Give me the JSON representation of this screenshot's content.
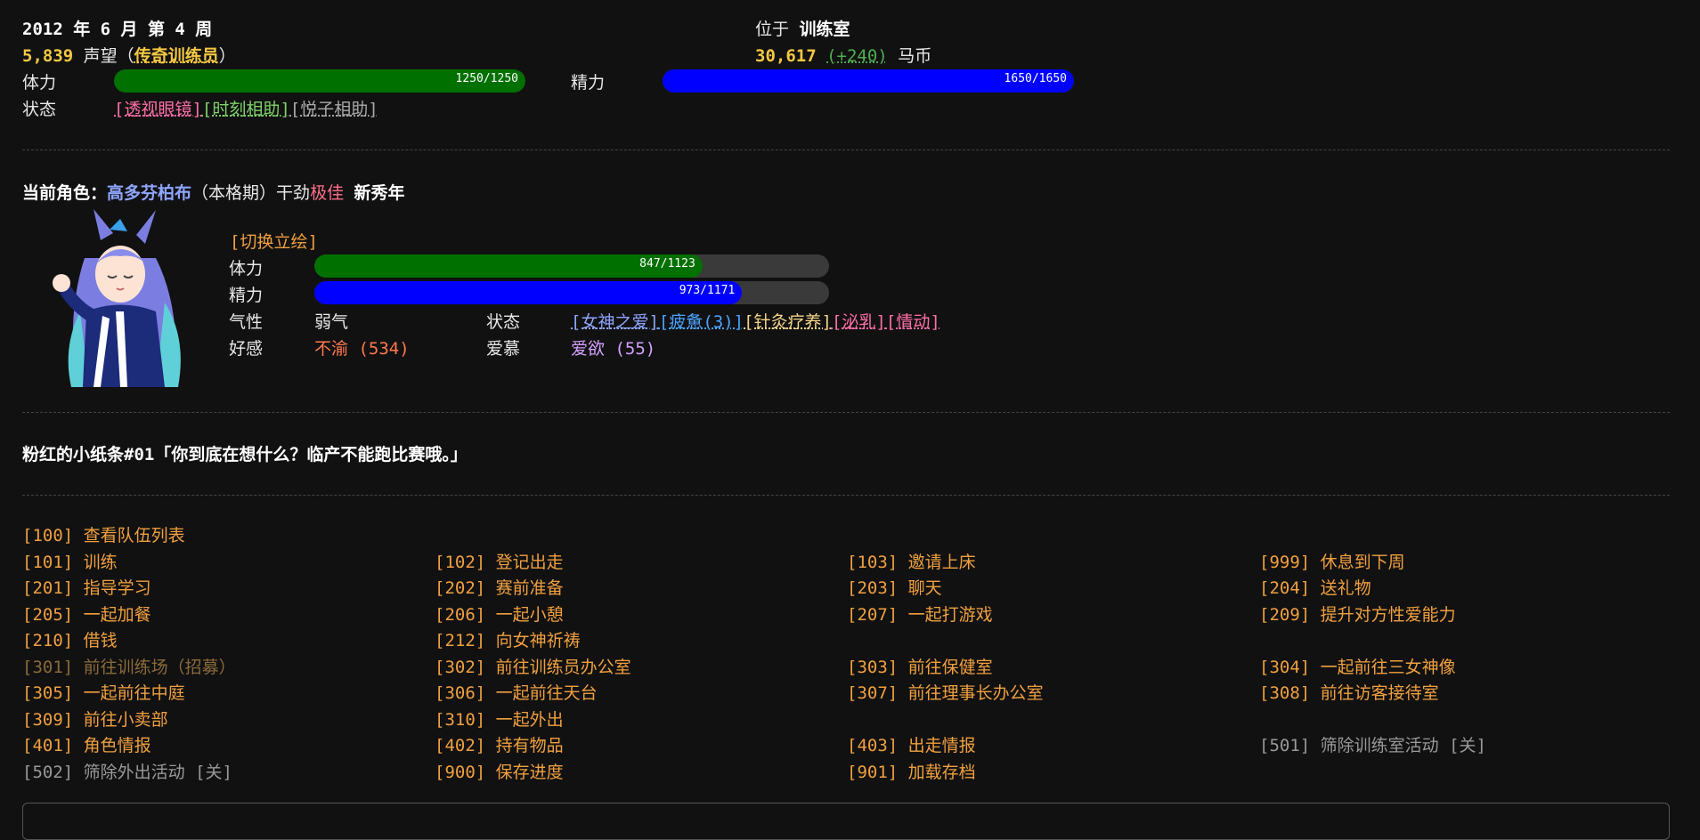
{
  "header": {
    "date": "2012 年 6 月 第 4 周",
    "reputation_value": "5,839",
    "reputation_label": "声望",
    "rank_open": "（",
    "rank": "传奇训练员",
    "rank_close": "）",
    "location_label": "位于",
    "location": "训练室",
    "money": "30,617",
    "money_delta": "(+240)",
    "money_unit": "马币"
  },
  "player": {
    "stamina_label": "体力",
    "stamina_text": "1250/1250",
    "stamina_fraction": 1.0,
    "energy_label": "精力",
    "energy_text": "1650/1650",
    "energy_fraction": 1.0,
    "status_label": "状态",
    "statuses": [
      {
        "text": "[透视眼镜]",
        "color": "#ff6fa8"
      },
      {
        "text": "[时刻相助]",
        "color": "#7fd36a"
      },
      {
        "text": "[悦子相助]",
        "color": "#aaaaaa"
      }
    ]
  },
  "character": {
    "prefix": "当前角色：",
    "name": "高多芬柏布",
    "period": "（本格期）",
    "drive_label": "干劲",
    "drive_value": "极佳",
    "tag": "新秀年",
    "switch_portrait": "[切换立绘]",
    "stamina_label": "体力",
    "stamina_text": "847/1123",
    "stamina_fraction": 0.754,
    "energy_label": "精力",
    "energy_text": "973/1171",
    "energy_fraction": 0.831,
    "temper_label": "气性",
    "temper_value": "弱气",
    "status_label": "状态",
    "statuses": [
      {
        "text": "[女神之爱]",
        "color": "#8fa6ff"
      },
      {
        "text": "[疲惫(3)]",
        "color": "#4aa3ff"
      },
      {
        "text": "[针灸疗养]",
        "color": "#f5d58a"
      },
      {
        "text": "[泌乳]",
        "color": "#ff6fa8"
      },
      {
        "text": "[情动]",
        "color": "#ff6fa8"
      }
    ],
    "affection_label": "好感",
    "affection_value": "不渝 (534)",
    "love_label": "爱慕",
    "love_value": "爱欲 (55)"
  },
  "note": {
    "title": "粉红的小纸条#01",
    "text": "「你到底在想什么？临产不能跑比赛哦。」"
  },
  "menu": [
    {
      "text": "[100] 查看队伍列表",
      "col": 0,
      "row": 0,
      "style": "normal"
    },
    {
      "text": "[101] 训练",
      "col": 0,
      "row": 1,
      "style": "normal"
    },
    {
      "text": "[102] 登记出走",
      "col": 1,
      "row": 1,
      "style": "normal"
    },
    {
      "text": "[103] 邀请上床",
      "col": 2,
      "row": 1,
      "style": "normal"
    },
    {
      "text": "[999] 休息到下周",
      "col": 3,
      "row": 1,
      "style": "normal"
    },
    {
      "text": "[201] 指导学习",
      "col": 0,
      "row": 2,
      "style": "normal"
    },
    {
      "text": "[202] 赛前准备",
      "col": 1,
      "row": 2,
      "style": "normal"
    },
    {
      "text": "[203] 聊天",
      "col": 2,
      "row": 2,
      "style": "normal"
    },
    {
      "text": "[204] 送礼物",
      "col": 3,
      "row": 2,
      "style": "normal"
    },
    {
      "text": "[205] 一起加餐",
      "col": 0,
      "row": 3,
      "style": "normal"
    },
    {
      "text": "[206] 一起小憩",
      "col": 1,
      "row": 3,
      "style": "normal"
    },
    {
      "text": "[207] 一起打游戏",
      "col": 2,
      "row": 3,
      "style": "normal"
    },
    {
      "text": "[209] 提升对方性爱能力",
      "col": 3,
      "row": 3,
      "style": "normal"
    },
    {
      "text": "[210] 借钱",
      "col": 0,
      "row": 4,
      "style": "normal"
    },
    {
      "text": "[212] 向女神祈祷",
      "col": 1,
      "row": 4,
      "style": "normal"
    },
    {
      "text": "[301] 前往训练场（招募）",
      "col": 0,
      "row": 5,
      "style": "dim"
    },
    {
      "text": "[302] 前往训练员办公室",
      "col": 1,
      "row": 5,
      "style": "normal"
    },
    {
      "text": "[303] 前往保健室",
      "col": 2,
      "row": 5,
      "style": "normal"
    },
    {
      "text": "[304] 一起前往三女神像",
      "col": 3,
      "row": 5,
      "style": "normal"
    },
    {
      "text": "[305] 一起前往中庭",
      "col": 0,
      "row": 6,
      "style": "normal"
    },
    {
      "text": "[306] 一起前往天台",
      "col": 1,
      "row": 6,
      "style": "normal"
    },
    {
      "text": "[307] 前往理事长办公室",
      "col": 2,
      "row": 6,
      "style": "normal"
    },
    {
      "text": "[308] 前往访客接待室",
      "col": 3,
      "row": 6,
      "style": "normal"
    },
    {
      "text": "[309] 前往小卖部",
      "col": 0,
      "row": 7,
      "style": "normal"
    },
    {
      "text": "[310] 一起外出",
      "col": 1,
      "row": 7,
      "style": "normal"
    },
    {
      "text": "[401] 角色情报",
      "col": 0,
      "row": 8,
      "style": "normal"
    },
    {
      "text": "[402] 持有物品",
      "col": 1,
      "row": 8,
      "style": "normal"
    },
    {
      "text": "[403] 出走情报",
      "col": 2,
      "row": 8,
      "style": "normal"
    },
    {
      "text": "[501] 筛除训练室活动 [关]",
      "col": 3,
      "row": 8,
      "style": "gray"
    },
    {
      "text": "[502] 筛除外出活动 [关]",
      "col": 0,
      "row": 9,
      "style": "gray"
    },
    {
      "text": "[900] 保存进度",
      "col": 1,
      "row": 9,
      "style": "normal"
    },
    {
      "text": "[901] 加载存档",
      "col": 2,
      "row": 9,
      "style": "normal"
    }
  ],
  "colors": {
    "background": "#111111",
    "stamina_bar": "#007000",
    "energy_bar": "#0000ff",
    "menu_text": "#f0a040",
    "character_name": "#8fa6ff",
    "drive_value": "#ff6f8a",
    "affection_value": "#ff7a50",
    "love_value": "#d6a0ff"
  }
}
